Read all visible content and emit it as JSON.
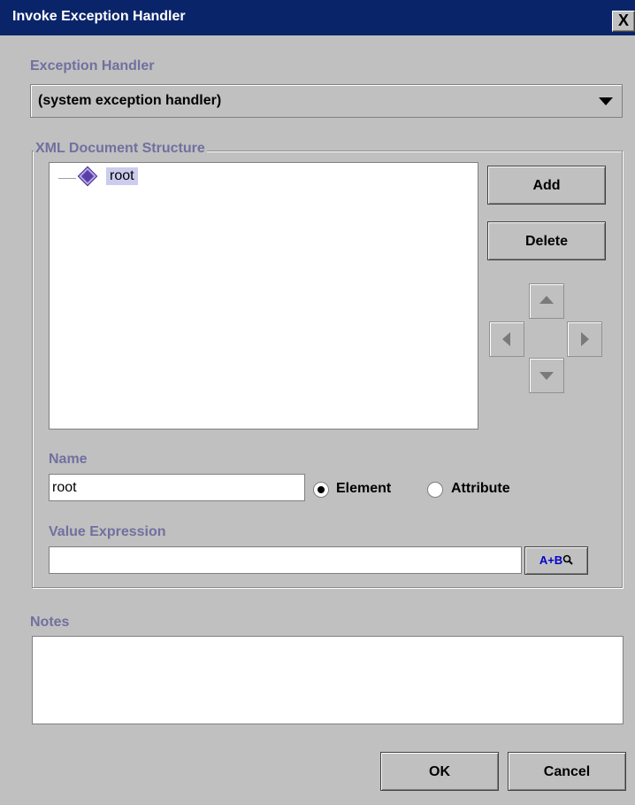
{
  "window": {
    "title": "Invoke Exception Handler",
    "close_glyph": "X"
  },
  "exception_handler": {
    "label": "Exception Handler",
    "selected": "(system exception handler)"
  },
  "xml_structure": {
    "label": "XML Document Structure",
    "tree": [
      {
        "label": "root",
        "selected": true
      }
    ],
    "add_label": "Add",
    "delete_label": "Delete"
  },
  "name": {
    "label": "Name",
    "value": "root",
    "element_label": "Element",
    "attribute_label": "Attribute",
    "selected_type": "Element"
  },
  "value_expression": {
    "label": "Value Expression",
    "value": "",
    "builder_label": "A+B"
  },
  "notes": {
    "label": "Notes",
    "value": ""
  },
  "footer": {
    "ok_label": "OK",
    "cancel_label": "Cancel"
  },
  "colors": {
    "titlebar": "#0a246a",
    "label": "#7070a0",
    "selection": "#ccccee"
  }
}
